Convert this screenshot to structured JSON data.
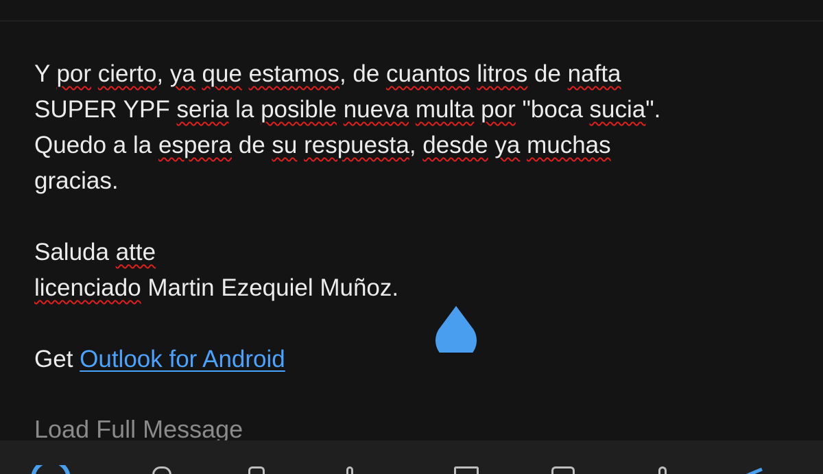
{
  "message": {
    "paragraph1": {
      "l1": [
        "Y ",
        "por",
        " ",
        "cierto",
        ", ",
        "ya",
        " ",
        "que",
        " ",
        "estamos",
        ", de ",
        "cuantos",
        " ",
        "litros",
        " de ",
        "nafta"
      ],
      "l2": [
        "SUPER YPF ",
        "seria",
        " la ",
        "posible",
        " ",
        "nueva",
        " ",
        "multa",
        " ",
        "por",
        " \"boca ",
        "sucia",
        "\"."
      ],
      "l3": [
        "Quedo a la ",
        "espera",
        " de ",
        "su",
        " ",
        "respuesta",
        ", ",
        "desde",
        " ",
        "ya",
        " ",
        "muchas"
      ],
      "l4": [
        "gracias."
      ]
    },
    "signature": {
      "l1": [
        "Saluda ",
        "atte"
      ],
      "l2": [
        "licenciado",
        " Martin Ezequiel Muñoz."
      ]
    },
    "footer": {
      "prefix": "Get ",
      "link_text": "Outlook for Android"
    }
  },
  "actions": {
    "load_full_message": "Load Full Message"
  },
  "colors": {
    "background": "#141414",
    "text": "#ececec",
    "link": "#4aa3ff",
    "spellcheck_underline": "#e0201c",
    "cursor_handle": "#4a9ef0",
    "muted_text": "#8a8a8a"
  }
}
